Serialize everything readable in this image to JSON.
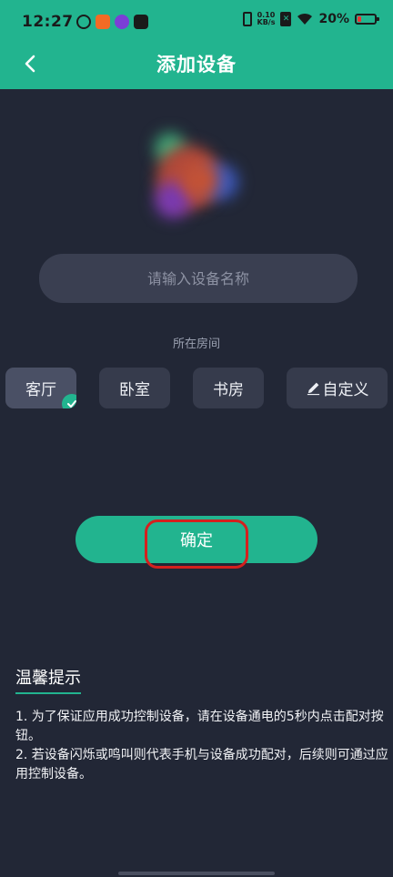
{
  "status_bar": {
    "time": "12:27",
    "net_speed_value": "0.10",
    "net_speed_unit": "KB/s",
    "battery_percent": "20%"
  },
  "header": {
    "title": "添加设备",
    "back_icon": "chevron-left-icon"
  },
  "form": {
    "name_placeholder": "请输入设备名称",
    "name_value": "",
    "room_label": "所在房间",
    "rooms": [
      {
        "label": "客厅",
        "selected": true
      },
      {
        "label": "卧室",
        "selected": false
      },
      {
        "label": "书房",
        "selected": false
      },
      {
        "label": "自定义",
        "selected": false,
        "icon": "pencil-icon"
      }
    ],
    "confirm_label": "确定"
  },
  "tips": {
    "title": "温馨提示",
    "items": [
      "1. 为了保证应用成功控制设备，请在设备通电的5秒内点击配对按钮。",
      "2. 若设备闪烁或鸣叫则代表手机与设备成功配对，后续则可通过应用控制设备。"
    ]
  },
  "colors": {
    "accent": "#22b48f",
    "background": "#222736",
    "annotation": "#d4201e"
  }
}
